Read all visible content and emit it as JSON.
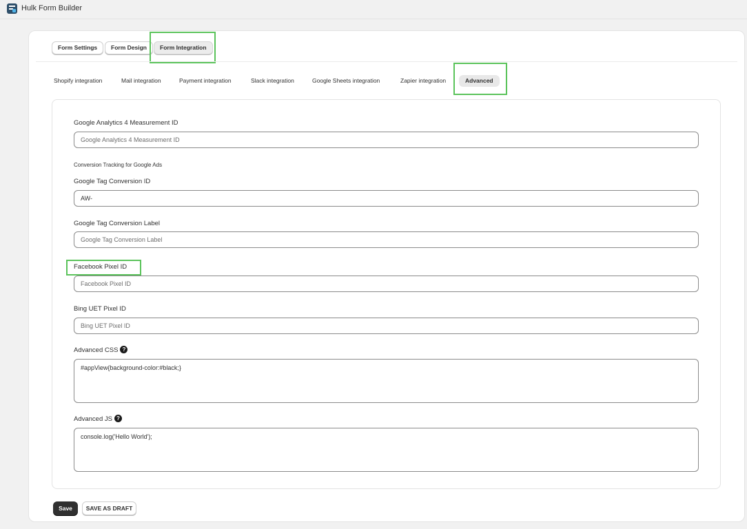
{
  "app": {
    "title": "Hulk Form Builder"
  },
  "tabs": [
    {
      "label": "Form Settings"
    },
    {
      "label": "Form Design"
    },
    {
      "label": "Form Integration",
      "active": true
    }
  ],
  "subtabs": [
    {
      "label": "Shopify integration"
    },
    {
      "label": "Mail integration"
    },
    {
      "label": "Payment integration"
    },
    {
      "label": "Slack integration"
    },
    {
      "label": "Google Sheets integration"
    },
    {
      "label": "Zapier integration"
    },
    {
      "label": "Advanced",
      "active": true
    }
  ],
  "form": {
    "ga4": {
      "label": "Google Analytics 4 Measurement ID",
      "placeholder": "Google Analytics 4 Measurement ID",
      "value": ""
    },
    "conversion_section": "Conversion Tracking for Google Ads",
    "tag_id": {
      "label": "Google Tag Conversion ID",
      "placeholder": "",
      "value": "AW-"
    },
    "tag_label": {
      "label": "Google Tag Conversion Label",
      "placeholder": "Google Tag Conversion Label",
      "value": ""
    },
    "fb_pixel": {
      "label": "Facebook Pixel ID",
      "placeholder": "Facebook Pixel ID",
      "value": ""
    },
    "bing": {
      "label": "Bing UET Pixel ID",
      "placeholder": "Bing UET Pixel ID",
      "value": ""
    },
    "css": {
      "label": "Advanced CSS",
      "value": "#appView{background-color:#black;}"
    },
    "js": {
      "label": "Advanced JS",
      "value": "console.log('Hello World');"
    }
  },
  "icons": {
    "help": "question-circle-icon",
    "logo": "hulk-form-builder-logo"
  },
  "actions": {
    "save": "Save",
    "draft": "SAVE AS DRAFT"
  },
  "colors": {
    "highlight": "#5ac35a",
    "primary_button": "#303030",
    "active_tab": "#e8e8e8"
  }
}
